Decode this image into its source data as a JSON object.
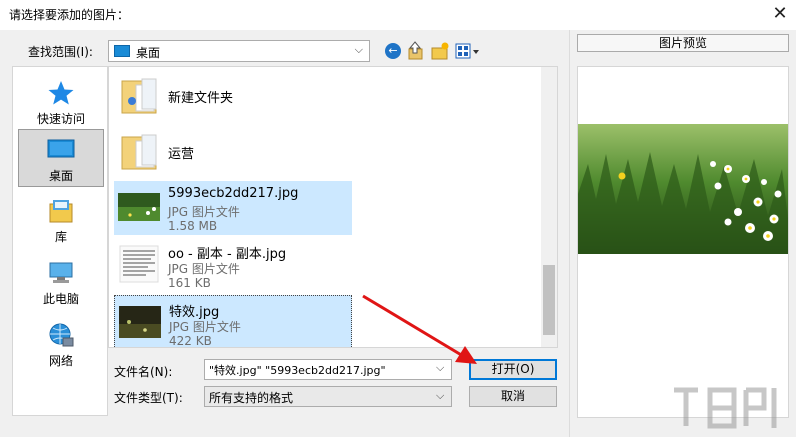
{
  "window": {
    "title": "请选择要添加的图片："
  },
  "toolbar": {
    "lookin_label": "查找范围(I):",
    "lookin_value": "桌面"
  },
  "sidebar": {
    "items": [
      {
        "label": "快速访问"
      },
      {
        "label": "桌面",
        "selected": true
      },
      {
        "label": "库"
      },
      {
        "label": "此电脑"
      },
      {
        "label": "网络"
      }
    ]
  },
  "files": [
    {
      "name": "新建文件夹",
      "kind": "folder"
    },
    {
      "name": "运营",
      "kind": "folder"
    },
    {
      "name": "5993ecb2dd217.jpg",
      "type": "JPG 图片文件",
      "size": "1.58 MB",
      "selected": true
    },
    {
      "name": "oo - 副本 - 副本.jpg",
      "type": "JPG 图片文件",
      "size": "161 KB"
    },
    {
      "name": "特效.jpg",
      "type": "JPG 图片文件",
      "size": "422 KB",
      "selected": true
    }
  ],
  "footer": {
    "filename_label": "文件名(N):",
    "filename_value": "\"特效.jpg\" \"5993ecb2dd217.jpg\"",
    "filetype_label": "文件类型(T):",
    "filetype_value": "所有支持的格式",
    "open_label": "打开(O)",
    "cancel_label": "取消"
  },
  "preview": {
    "title": "图片预览"
  },
  "colors": {
    "selection": "#cce8ff",
    "accent": "#0078d7",
    "arrow": "#e01515"
  }
}
